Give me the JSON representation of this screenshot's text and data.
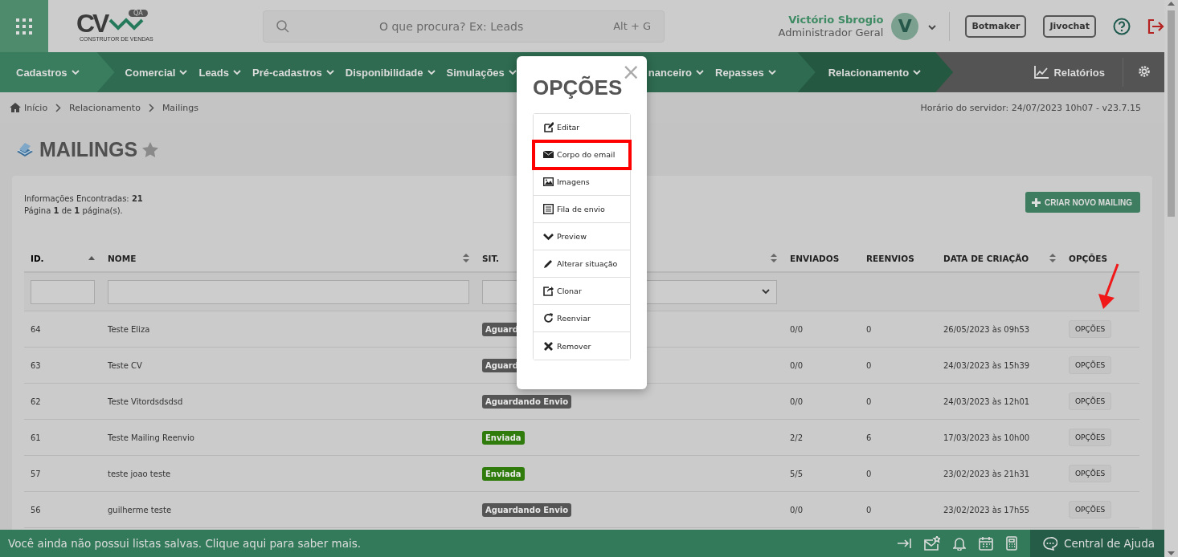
{
  "header": {
    "logo": {
      "mark": "CV",
      "badge": "QA",
      "tagline": "CONSTRUTOR DE VENDAS"
    },
    "search": {
      "placeholder": "O que procura? Ex: Leads",
      "shortcut": "Alt + G"
    },
    "user": {
      "name": "Victório Sbrogio",
      "role": "Administrador Geral",
      "initial": "V"
    },
    "buttons": [
      "Botmaker",
      "Jivochat"
    ]
  },
  "nav": {
    "items": [
      {
        "label": "Cadastros",
        "kind": "block",
        "selected": false
      },
      {
        "label": "Comercial",
        "kind": "item",
        "selected": false
      },
      {
        "label": "Leads",
        "kind": "item",
        "selected": false
      },
      {
        "label": "Pré-cadastros",
        "kind": "item",
        "selected": false
      },
      {
        "label": "Disponibilidade",
        "kind": "item",
        "selected": false
      },
      {
        "label": "Simulações",
        "kind": "item",
        "selected": false
      },
      {
        "label": "nanceiro",
        "kind": "item",
        "selected": false
      },
      {
        "label": "Repasses",
        "kind": "item",
        "selected": false
      },
      {
        "label": "Relacionamento",
        "kind": "block",
        "selected": true
      }
    ],
    "reports": "Relatórios"
  },
  "breadcrumb": [
    "Início",
    "Relacionamento",
    "Mailings"
  ],
  "server_time": "Horário do servidor: 24/07/2023 10h07 - v23.7.15",
  "page_title": "MAILINGS",
  "summary": [
    "Informações Encontradas: **21**",
    "Página **1** de **1** página(s)."
  ],
  "create_button": "CRIAR NOVO MAILING",
  "table": {
    "columns": [
      {
        "label": "ID.",
        "sortable": true,
        "sorted": true
      },
      {
        "label": "NOME",
        "sortable": true,
        "sorted": false
      },
      {
        "label": "SIT.",
        "sortable": true,
        "sorted": false
      },
      {
        "label": "ENVIADOS",
        "sortable": false
      },
      {
        "label": "REENVIOS",
        "sortable": false
      },
      {
        "label": "DATA DE CRIAÇÃO",
        "sortable": true,
        "sorted": false
      },
      {
        "label": "OPÇÕES",
        "sortable": false
      }
    ],
    "filters": [
      {
        "kind": "text"
      },
      {
        "kind": "text"
      },
      {
        "kind": "select"
      }
    ],
    "rows": [
      {
        "id": "64",
        "name": "Teste Eliza",
        "status": "Aguard",
        "color": "#555555",
        "sent": "0/0",
        "resends": "0",
        "created": "26/05/2023 às 09h53",
        "options": "OPÇÕES"
      },
      {
        "id": "63",
        "name": "Teste CV",
        "status": "Aguard",
        "color": "#555555",
        "sent": "0/0",
        "resends": "0",
        "created": "24/03/2023 às 15h39",
        "options": "OPÇÕES"
      },
      {
        "id": "62",
        "name": "Teste Vitordsdsdsd",
        "status": "Aguardando Envio",
        "color": "#555555",
        "sent": "0/0",
        "resends": "0",
        "created": "24/03/2023 às 12h01",
        "options": "OPÇÕES"
      },
      {
        "id": "61",
        "name": "Teste Mailing Reenvio",
        "status": "Enviada",
        "color": "#2f7c0c",
        "sent": "2/2",
        "resends": "6",
        "created": "17/03/2023 às 10h00",
        "options": "OPÇÕES"
      },
      {
        "id": "57",
        "name": "teste joao teste",
        "status": "Enviada",
        "color": "#2f7c0c",
        "sent": "5/5",
        "resends": "0",
        "created": "23/02/2023 às 21h31",
        "options": "OPÇÕES"
      },
      {
        "id": "56",
        "name": "guilherme teste",
        "status": "Aguardando Envio",
        "color": "#555555",
        "sent": "0/0",
        "resends": "0",
        "created": "23/02/2023 às 17h55",
        "options": "OPÇÕES"
      }
    ]
  },
  "modal": {
    "title": "OPÇÕES",
    "close": "×",
    "items": [
      {
        "label": "Editar",
        "highlighted": false
      },
      {
        "label": "Corpo do email",
        "highlighted": true
      },
      {
        "label": "Imagens",
        "highlighted": false
      },
      {
        "label": "Fila de envio",
        "highlighted": false
      },
      {
        "label": "Preview",
        "highlighted": false
      },
      {
        "label": "Alterar situação",
        "highlighted": false
      },
      {
        "label": "Clonar",
        "highlighted": false
      },
      {
        "label": "Reenviar",
        "highlighted": false
      },
      {
        "label": "Remover",
        "highlighted": false
      }
    ]
  },
  "footer": {
    "message": "Você ainda não possui listas salvas. Clique aqui para saber mais.",
    "help": "Central de Ajuda"
  }
}
